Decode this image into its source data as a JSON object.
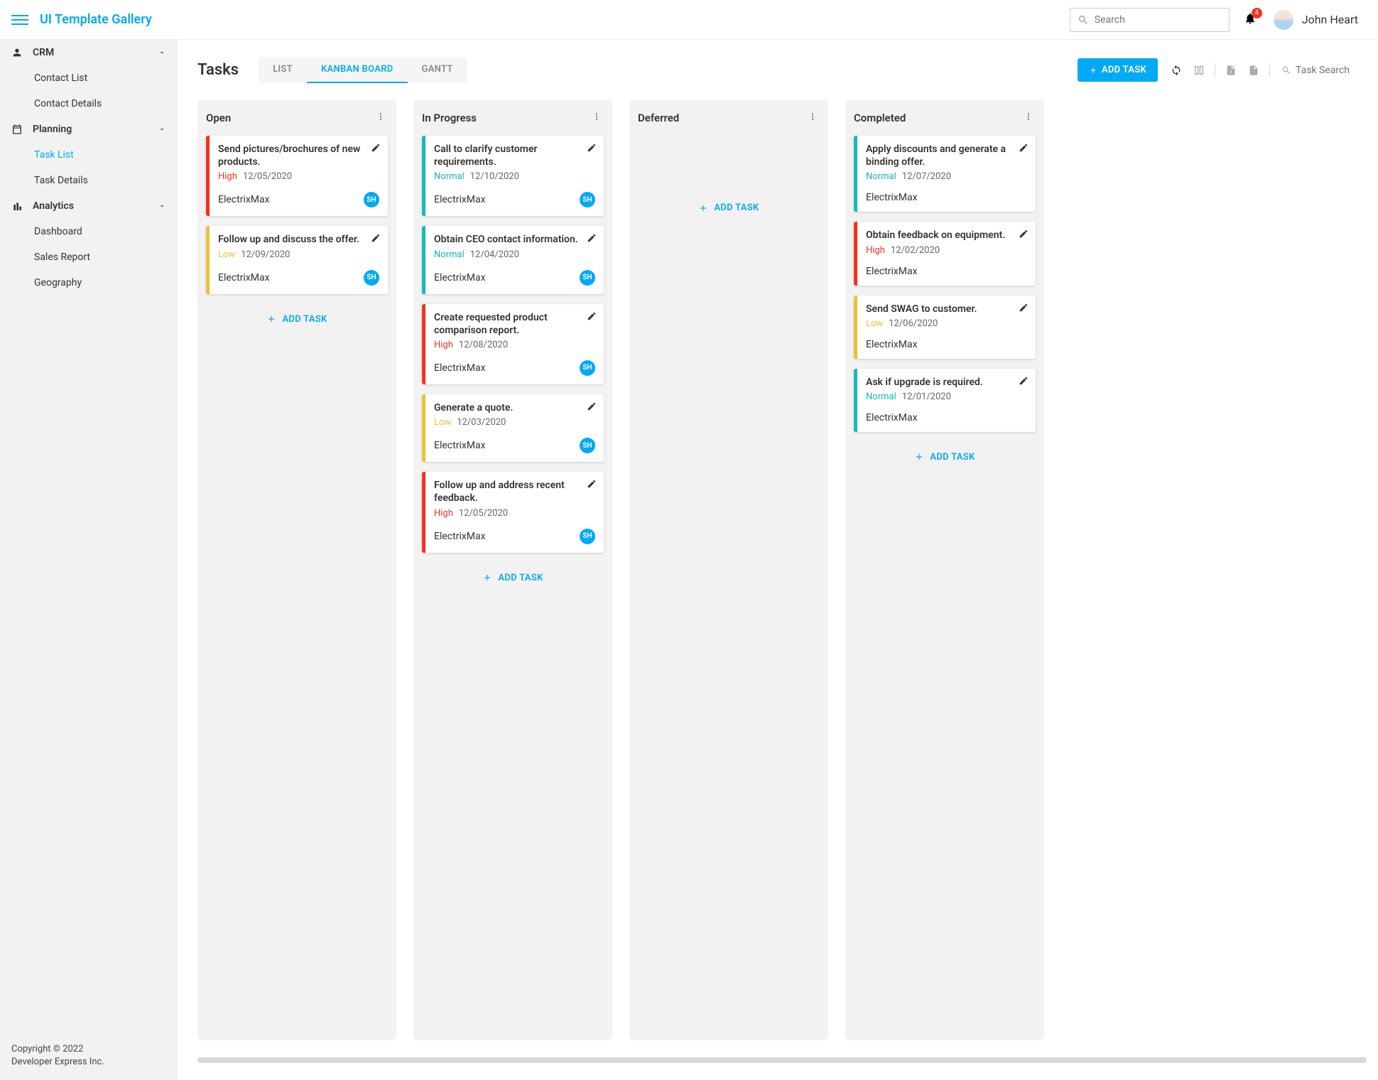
{
  "header": {
    "app_title": "UI Template Gallery",
    "search_placeholder": "Search",
    "notif_count": "4",
    "user_name": "John Heart"
  },
  "sidebar": {
    "sections": [
      {
        "label": "CRM",
        "items": [
          {
            "label": "Contact List",
            "active": false
          },
          {
            "label": "Contact Details",
            "active": false
          }
        ]
      },
      {
        "label": "Planning",
        "items": [
          {
            "label": "Task List",
            "active": true
          },
          {
            "label": "Task Details",
            "active": false
          }
        ]
      },
      {
        "label": "Analytics",
        "items": [
          {
            "label": "Dashboard",
            "active": false
          },
          {
            "label": "Sales Report",
            "active": false
          },
          {
            "label": "Geography",
            "active": false
          }
        ]
      }
    ],
    "footer": {
      "line1": "Copyright © 2022",
      "line2": "Developer Express Inc."
    }
  },
  "page": {
    "title": "Tasks",
    "tabs": [
      {
        "label": "LIST",
        "active": false
      },
      {
        "label": "KANBAN BOARD",
        "active": true
      },
      {
        "label": "GANTT",
        "active": false
      }
    ],
    "add_task_label": "ADD TASK",
    "task_search_placeholder": "Task Search",
    "col_add_task_label": "ADD TASK",
    "columns": [
      {
        "title": "Open",
        "cards": [
          {
            "title": "Send pictures/brochures of new products.",
            "priority": "High",
            "date": "12/05/2020",
            "company": "ElectrixMax",
            "assignee": "SH"
          },
          {
            "title": "Follow up and discuss the offer.",
            "priority": "Low",
            "date": "12/09/2020",
            "company": "ElectrixMax",
            "assignee": "SH"
          }
        ]
      },
      {
        "title": "In Progress",
        "cards": [
          {
            "title": "Call to clarify customer requirements.",
            "priority": "Normal",
            "date": "12/10/2020",
            "company": "ElectrixMax",
            "assignee": "SH"
          },
          {
            "title": "Obtain CEO contact information.",
            "priority": "Normal",
            "date": "12/04/2020",
            "company": "ElectrixMax",
            "assignee": "SH"
          },
          {
            "title": "Create requested product comparison report.",
            "priority": "High",
            "date": "12/08/2020",
            "company": "ElectrixMax",
            "assignee": "SH"
          },
          {
            "title": "Generate a quote.",
            "priority": "Low",
            "date": "12/03/2020",
            "company": "ElectrixMax",
            "assignee": "SH"
          },
          {
            "title": "Follow up and address recent feedback.",
            "priority": "High",
            "date": "12/05/2020",
            "company": "ElectrixMax",
            "assignee": "SH"
          }
        ]
      },
      {
        "title": "Deferred",
        "cards": []
      },
      {
        "title": "Completed",
        "cards": [
          {
            "title": "Apply discounts and generate a binding offer.",
            "priority": "Normal",
            "date": "12/07/2020",
            "company": "ElectrixMax",
            "assignee": ""
          },
          {
            "title": "Obtain feedback on equipment.",
            "priority": "High",
            "date": "12/02/2020",
            "company": "ElectrixMax",
            "assignee": ""
          },
          {
            "title": "Send SWAG to customer.",
            "priority": "Low",
            "date": "12/06/2020",
            "company": "ElectrixMax",
            "assignee": ""
          },
          {
            "title": "Ask if upgrade is required.",
            "priority": "Normal",
            "date": "12/01/2020",
            "company": "ElectrixMax",
            "assignee": ""
          }
        ]
      }
    ]
  },
  "colors": {
    "accent": "#03a9f4",
    "high": "#f5311f",
    "normal": "#14bcb2",
    "low": "#edc234"
  }
}
